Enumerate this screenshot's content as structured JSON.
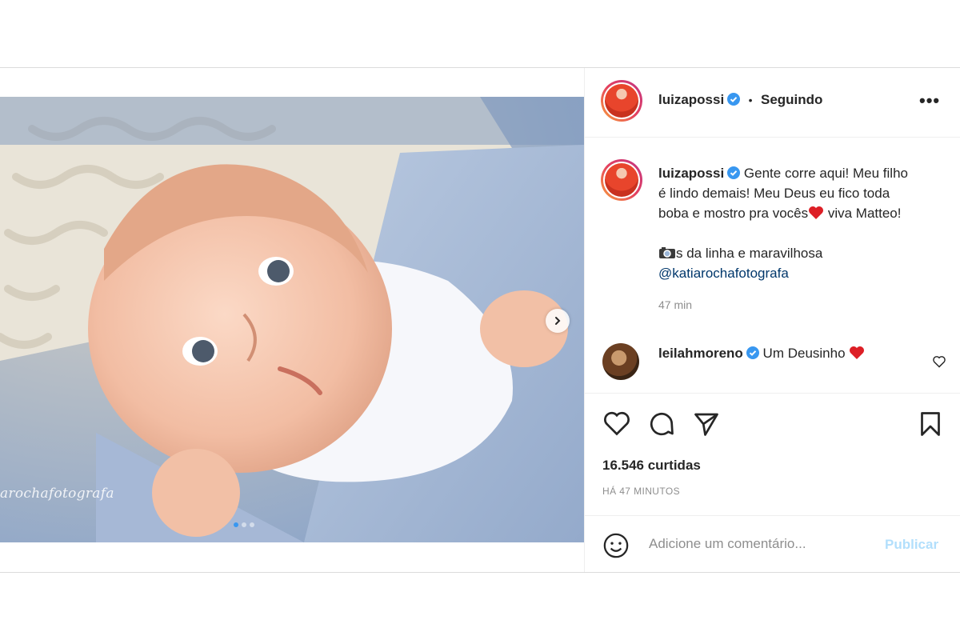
{
  "post": {
    "author": "luizapossi",
    "follow_separator": "•",
    "follow_status": "Seguindo",
    "more_glyph": "•••",
    "caption": {
      "author": "luizapossi",
      "line1": "Gente corre aqui! Meu filho",
      "line2": "é lindo demais! Meu Deus eu fico toda",
      "line3_a": "boba e mostro pra vocês",
      "line3_b": " viva Matteo!",
      "line5": "s da linha e maravilhosa",
      "mention": "@katiarochafotografa",
      "time": "47 min"
    },
    "comment": {
      "author": "leilahmoreno",
      "text": "Um Deusinho"
    },
    "likes": "16.546 curtidas",
    "posted_ago": "HÁ 47 MINUTOS",
    "composer": {
      "placeholder": "Adicione um comentário...",
      "publish": "Publicar"
    },
    "watermark": "arochafotografa",
    "carousel": {
      "slides": 3,
      "active": 1
    }
  },
  "colors": {
    "verified": "#3897f0",
    "heart": "#e0245e",
    "publish_disabled": "#b2dffc",
    "link": "#00376b"
  },
  "icons": [
    "verified-icon",
    "more-icon",
    "chevron-right-icon",
    "heart-icon",
    "comment-icon",
    "share-icon",
    "bookmark-icon",
    "emoji-icon",
    "red-heart-emoji",
    "camera-emoji"
  ]
}
